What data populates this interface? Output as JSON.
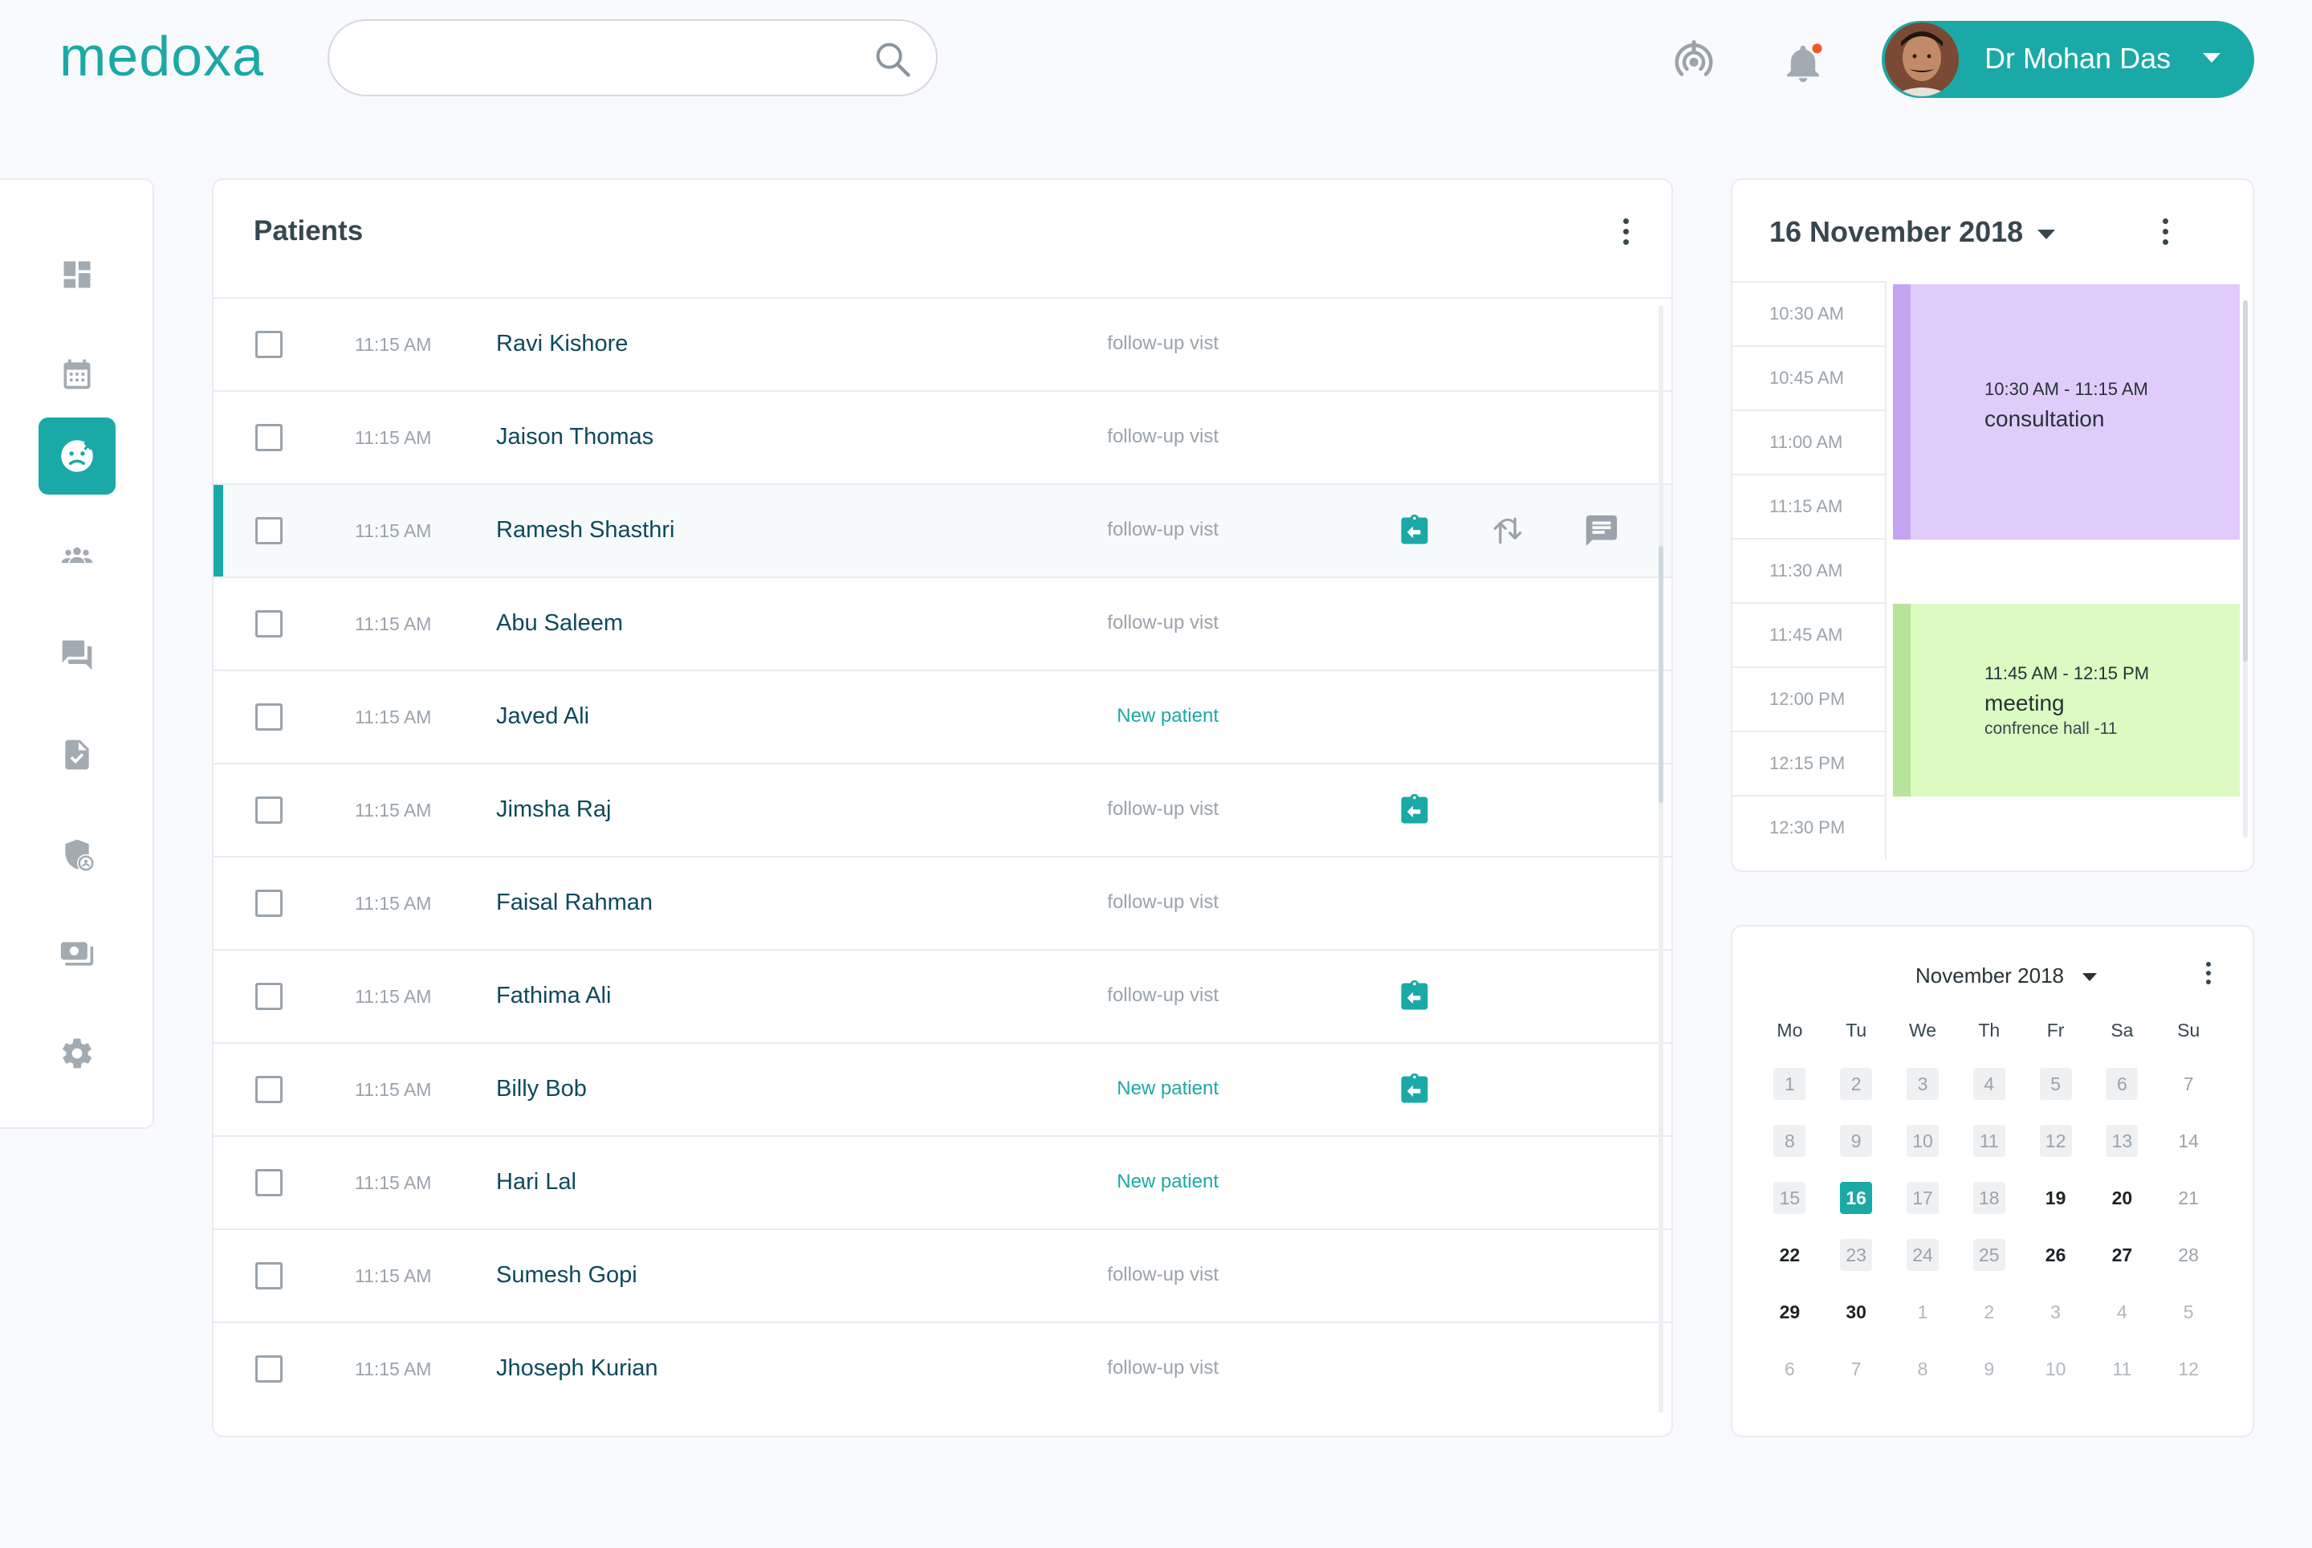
{
  "brand": {
    "name": "medoxa",
    "accent": "#1aa9a7"
  },
  "search": {
    "value": "",
    "placeholder": ""
  },
  "header_icons": [
    "wifi-tethering-icon",
    "notification-bell-icon"
  ],
  "user": {
    "name": "Dr Mohan Das"
  },
  "sidebar": {
    "items": [
      {
        "id": "dashboard",
        "icon": "dashboard-icon",
        "active": false
      },
      {
        "id": "calendar",
        "icon": "calendar-icon",
        "active": false
      },
      {
        "id": "patients",
        "icon": "patient-face-icon",
        "active": true
      },
      {
        "id": "groups",
        "icon": "people-group-icon",
        "active": false
      },
      {
        "id": "messages",
        "icon": "chat-forum-icon",
        "active": false
      },
      {
        "id": "documents",
        "icon": "document-check-icon",
        "active": false
      },
      {
        "id": "security",
        "icon": "shield-user-icon",
        "active": false
      },
      {
        "id": "payments",
        "icon": "money-icon",
        "active": false
      },
      {
        "id": "settings",
        "icon": "gear-icon",
        "active": false
      }
    ]
  },
  "patients": {
    "title": "Patients",
    "rows": [
      {
        "time": "11:15 AM",
        "name": "Ravi Kishore",
        "status": "follow-up vist",
        "new": false,
        "actions": []
      },
      {
        "time": "11:15 AM",
        "name": "Jaison Thomas",
        "status": "follow-up vist",
        "new": false,
        "actions": []
      },
      {
        "time": "11:15 AM",
        "name": "Ramesh Shasthri",
        "status": "follow-up vist",
        "new": false,
        "selected": true,
        "actions": [
          "checkin",
          "swap",
          "message"
        ]
      },
      {
        "time": "11:15 AM",
        "name": "Abu Saleem",
        "status": "follow-up vist",
        "new": false,
        "actions": []
      },
      {
        "time": "11:15 AM",
        "name": "Javed Ali",
        "status": "New patient",
        "new": true,
        "actions": []
      },
      {
        "time": "11:15 AM",
        "name": "Jimsha Raj",
        "status": "follow-up vist",
        "new": false,
        "actions": [
          "checkin"
        ]
      },
      {
        "time": "11:15 AM",
        "name": "Faisal Rahman",
        "status": "follow-up vist",
        "new": false,
        "actions": []
      },
      {
        "time": "11:15 AM",
        "name": "Fathima Ali",
        "status": "follow-up vist",
        "new": false,
        "actions": [
          "checkin"
        ]
      },
      {
        "time": "11:15 AM",
        "name": "Billy Bob",
        "status": "New patient",
        "new": true,
        "actions": [
          "checkin"
        ]
      },
      {
        "time": "11:15 AM",
        "name": "Hari Lal",
        "status": "New patient",
        "new": true,
        "actions": []
      },
      {
        "time": "11:15 AM",
        "name": "Sumesh Gopi",
        "status": "follow-up vist",
        "new": false,
        "actions": []
      },
      {
        "time": "11:15 AM",
        "name": "Jhoseph Kurian",
        "status": "follow-up vist",
        "new": false,
        "actions": []
      }
    ]
  },
  "schedule": {
    "date": "16 November 2018",
    "slots": [
      "10:30 AM",
      "10:45 AM",
      "11:00 AM",
      "11:15 AM",
      "11:30 AM",
      "11:45 AM",
      "12:00 PM",
      "12:15 PM",
      "12:30 PM"
    ],
    "events": [
      {
        "time": "10:30 AM - 11:15 AM",
        "title": "consultation",
        "subtitle": "",
        "color": "#e0ccfb",
        "bar_color": "#c4a5f3"
      },
      {
        "time": "11:45 AM - 12:15 PM",
        "title": "meeting",
        "subtitle": "confrence hall -11",
        "color": "#dcfbc2",
        "bar_color": "#b7e39a"
      }
    ]
  },
  "calendar": {
    "title": "November 2018",
    "weekdays": [
      "Mo",
      "Tu",
      "We",
      "Th",
      "Fr",
      "Sa",
      "Su"
    ],
    "weeks": [
      [
        {
          "d": "1",
          "s": "past"
        },
        {
          "d": "2",
          "s": "past"
        },
        {
          "d": "3",
          "s": "past"
        },
        {
          "d": "4",
          "s": "past"
        },
        {
          "d": "5",
          "s": "past"
        },
        {
          "d": "6",
          "s": "past"
        },
        {
          "d": "7",
          "s": "weekend"
        }
      ],
      [
        {
          "d": "8",
          "s": "past"
        },
        {
          "d": "9",
          "s": "past"
        },
        {
          "d": "10",
          "s": "past"
        },
        {
          "d": "11",
          "s": "past"
        },
        {
          "d": "12",
          "s": "past"
        },
        {
          "d": "13",
          "s": "past"
        },
        {
          "d": "14",
          "s": "weekend"
        }
      ],
      [
        {
          "d": "15",
          "s": "past"
        },
        {
          "d": "16",
          "s": "today"
        },
        {
          "d": "17",
          "s": "past"
        },
        {
          "d": "18",
          "s": "past"
        },
        {
          "d": "19",
          "s": "future"
        },
        {
          "d": "20",
          "s": "future"
        },
        {
          "d": "21",
          "s": "weekend"
        }
      ],
      [
        {
          "d": "22",
          "s": "future"
        },
        {
          "d": "23",
          "s": "past"
        },
        {
          "d": "24",
          "s": "past"
        },
        {
          "d": "25",
          "s": "past"
        },
        {
          "d": "26",
          "s": "future"
        },
        {
          "d": "27",
          "s": "future"
        },
        {
          "d": "28",
          "s": "weekend"
        }
      ],
      [
        {
          "d": "29",
          "s": "future"
        },
        {
          "d": "30",
          "s": "future"
        },
        {
          "d": "1",
          "s": "other"
        },
        {
          "d": "2",
          "s": "other"
        },
        {
          "d": "3",
          "s": "other"
        },
        {
          "d": "4",
          "s": "other"
        },
        {
          "d": "5",
          "s": "other"
        }
      ],
      [
        {
          "d": "6",
          "s": "other"
        },
        {
          "d": "7",
          "s": "other"
        },
        {
          "d": "8",
          "s": "other"
        },
        {
          "d": "9",
          "s": "other"
        },
        {
          "d": "10",
          "s": "other"
        },
        {
          "d": "11",
          "s": "other"
        },
        {
          "d": "12",
          "s": "other"
        }
      ]
    ]
  }
}
